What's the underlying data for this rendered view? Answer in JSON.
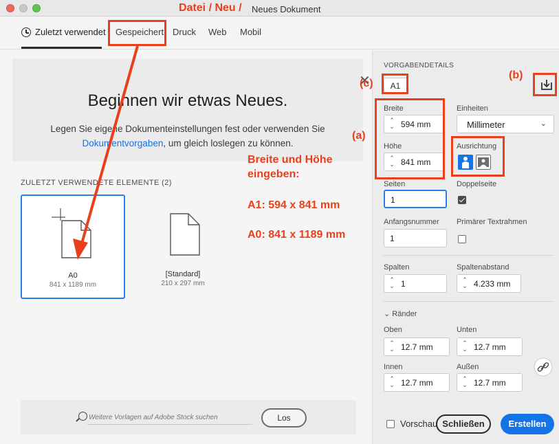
{
  "window": {
    "title_annotation": "Datei / Neu /",
    "title": "Neues Dokument"
  },
  "tabs": [
    {
      "label": "Zuletzt verwendet",
      "active": true
    },
    {
      "label": "Gespeichert"
    },
    {
      "label": "Druck"
    },
    {
      "label": "Web"
    },
    {
      "label": "Mobil"
    }
  ],
  "welcome": {
    "title": "Beginnen wir etwas Neues.",
    "text_before": "Legen Sie eigene Dokumenteinstellungen fest oder verwenden Sie",
    "link": "Dokumentvorgaben",
    "text_after": ", um gleich loslegen zu können."
  },
  "recent": {
    "heading": "ZULETZT VERWENDETE ELEMENTE",
    "count": "(2)",
    "items": [
      {
        "name": "A0",
        "size": "841 x 1189 mm"
      },
      {
        "name": "[Standard]",
        "size": "210 x 297 mm"
      }
    ]
  },
  "search": {
    "placeholder": "Weitere Vorlagen auf Adobe Stock suchen",
    "button": "Los"
  },
  "details": {
    "heading": "VORGABENDETAILS",
    "preset_name": "A1",
    "width_label": "Breite",
    "width_value": "594 mm",
    "units_label": "Einheiten",
    "units_value": "Millimeter",
    "height_label": "Höhe",
    "height_value": "841 mm",
    "orientation_label": "Ausrichtung",
    "pages_label": "Seiten",
    "pages_value": "1",
    "facing_label": "Doppelseite",
    "facing_checked": true,
    "start_label": "Anfangsnummer",
    "start_value": "1",
    "primary_frame_label": "Primärer Textrahmen",
    "primary_frame_checked": false,
    "columns_label": "Spalten",
    "columns_value": "1",
    "gutter_label": "Spaltenabstand",
    "gutter_value": "4.233 mm",
    "margins_label": "Ränder",
    "top_label": "Oben",
    "top_value": "12.7 mm",
    "bottom_label": "Unten",
    "bottom_value": "12.7 mm",
    "inside_label": "Innen",
    "inside_value": "12.7 mm",
    "outside_label": "Außen",
    "outside_value": "12.7 mm"
  },
  "footer": {
    "preview_label": "Vorschau",
    "close_button": "Schließen",
    "create_button": "Erstellen"
  },
  "annotations": {
    "label_a": "(a)",
    "label_b": "(b)",
    "label_c": "(c)",
    "line1": "Breite und Höhe",
    "line2": "eingeben:",
    "a1": "A1:  594 x 841 mm",
    "a0": "A0:  841 x 1189 mm"
  },
  "colors": {
    "annotation": "#e8401c",
    "accent": "#1473e6",
    "selection": "#2680eb"
  },
  "icons": {
    "tab_recent": "clock-icon",
    "search": "search-icon",
    "save_preset": "save-preset-icon",
    "link": "chain-link-icon",
    "portrait": "portrait-orientation-icon",
    "landscape": "landscape-orientation-icon",
    "close": "close-icon",
    "units_chevron": "chevron-down-icon",
    "margins_chevron": "chevron-down-icon"
  }
}
